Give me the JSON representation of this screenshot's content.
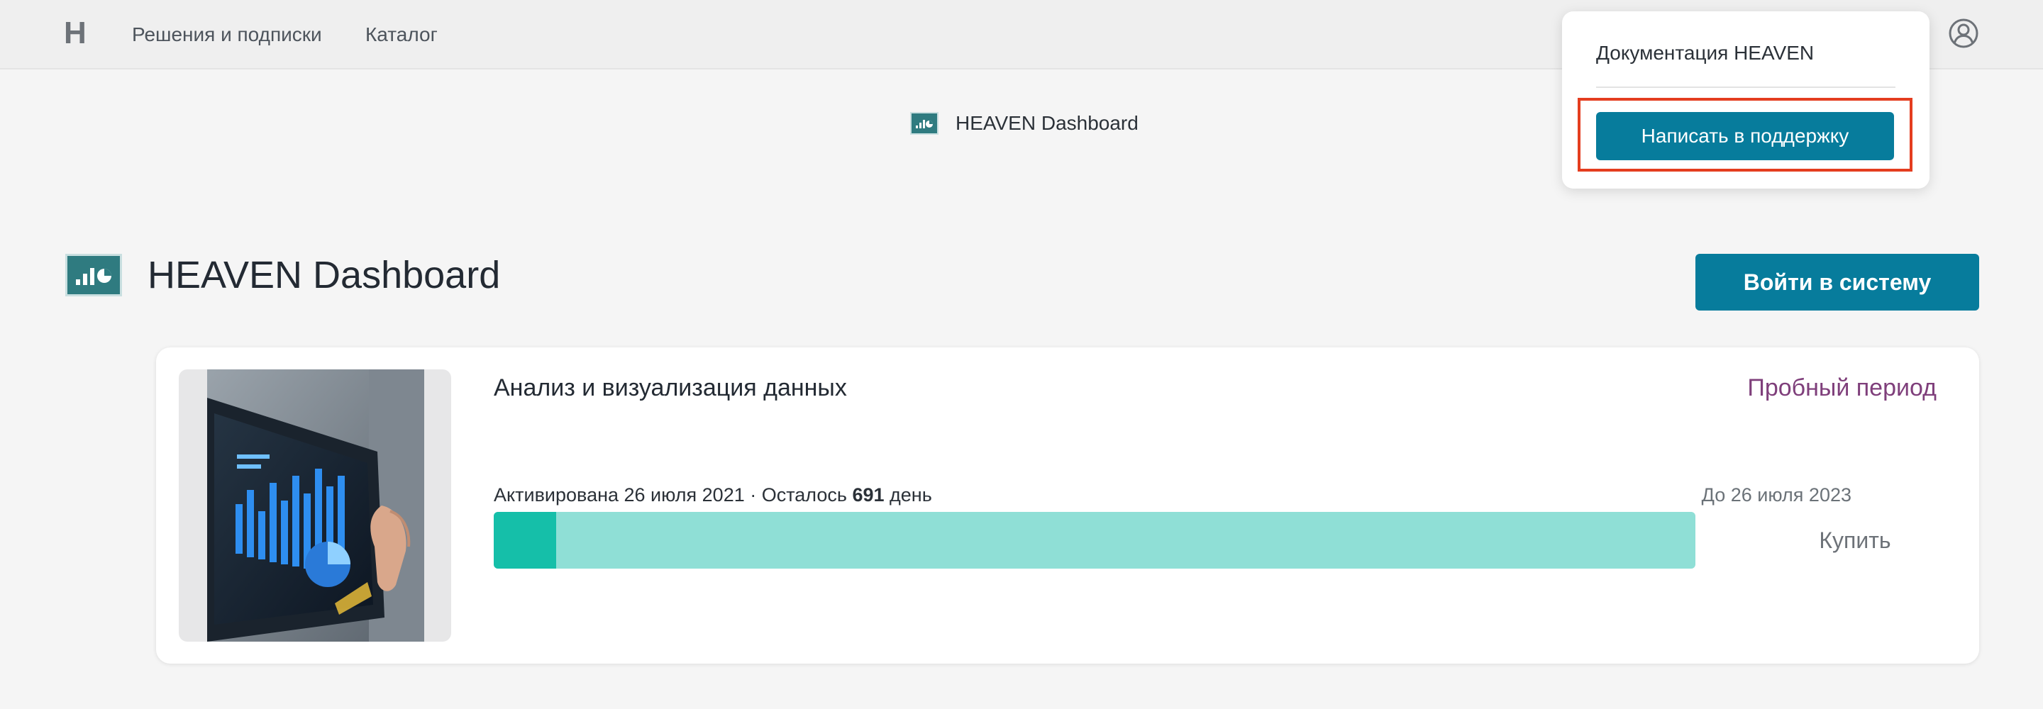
{
  "topbar": {
    "logo": "H",
    "nav": {
      "solutions": "Решения и подписки",
      "catalog": "Каталог"
    },
    "user_icon": "user-circle-icon"
  },
  "breadcrumb": {
    "icon": "dashboard-icon",
    "title": "HEAVEN Dashboard"
  },
  "product": {
    "icon": "dashboard-icon",
    "title": "HEAVEN Dashboard",
    "login_label": "Войти в систему"
  },
  "subscription": {
    "image": "tablet-analytics-photo",
    "plan_name": "Анализ и визуализация данных",
    "status": "Пробный период",
    "activation_prefix": "Активирована 26 июля 2021 · Осталось ",
    "days_left": "691",
    "days_suffix": " день",
    "until": "До 26 июля 2023",
    "progress_fraction": 0.052,
    "buy_label": "Купить"
  },
  "dropdown": {
    "documentation": "Документация HEAVEN",
    "support_label": "Написать в поддержку"
  },
  "colors": {
    "accent": "#077c9c",
    "status": "#7f3f7b",
    "progress_track": "#8fdfd6",
    "progress_fill": "#15bfa9",
    "highlight": "#e43d1f"
  }
}
